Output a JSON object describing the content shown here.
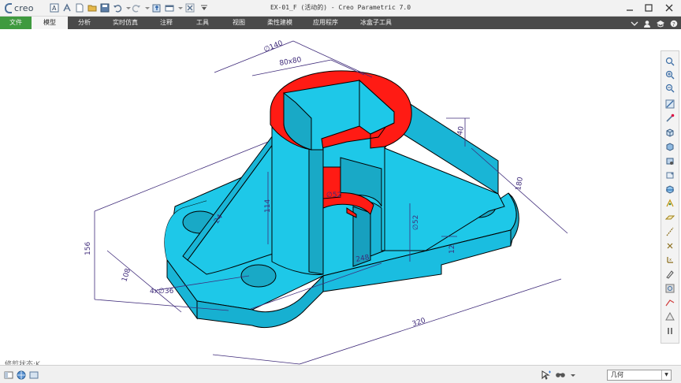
{
  "app": {
    "brand": "creo",
    "window_title": "EX-01_F (活动的) - Creo Parametric 7.0"
  },
  "menu": {
    "tabs": [
      "文件",
      "模型",
      "分析",
      "实时仿真",
      "注释",
      "工具",
      "视图",
      "柔性建模",
      "应用程序",
      "冰盒子工具"
    ],
    "active_tab": "模型"
  },
  "canvas": {
    "trim_status": "修剪状态:K",
    "dimensions": {
      "d140": "∅140",
      "d80x80": "80x80",
      "d40": "40",
      "d180": "180",
      "d24": "24",
      "d114": "114",
      "d52a": "∅52",
      "d52b": "∅52",
      "d12": "12",
      "d156": "156",
      "d108": "108",
      "d4x36": "4x∅36",
      "d248": "248",
      "d320": "320"
    }
  },
  "colors": {
    "body": "#1ec8e8",
    "body_dark": "#19a9c6",
    "cut": "#ff1b14",
    "dimension": "#3f2b7a",
    "menubar": "#4a4a4a",
    "file_tab": "#3f9a3f"
  },
  "statusbar": {
    "filter_value": "几何"
  }
}
